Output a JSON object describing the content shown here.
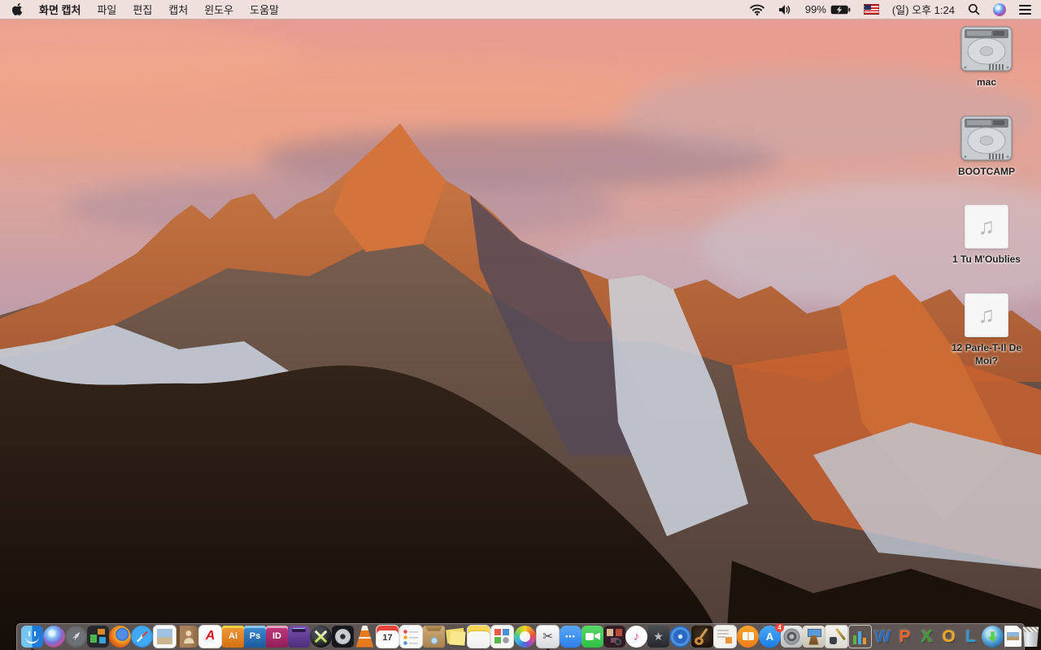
{
  "menu_bar": {
    "app_name": "화면 캡처",
    "menus": [
      "파일",
      "편집",
      "캡처",
      "윈도우",
      "도움말"
    ],
    "battery_percent": "99%",
    "clock": "(일) 오후 1:24"
  },
  "desktop": {
    "icons": [
      {
        "name": "drive-mac",
        "type": "drive",
        "label": "mac"
      },
      {
        "name": "drive-bootcamp",
        "type": "drive",
        "label": "BOOTCAMP"
      },
      {
        "name": "audio-file-1",
        "type": "audio",
        "label": "1 Tu M'Oublies",
        "glyph": "♫"
      },
      {
        "name": "audio-file-2",
        "type": "audio",
        "label": "12 Parle-T-Il De Moi?",
        "glyph": "♫"
      }
    ]
  },
  "dock": {
    "items": [
      {
        "name": "finder",
        "running": true
      },
      {
        "name": "siri"
      },
      {
        "name": "launchpad"
      },
      {
        "name": "mission-control"
      },
      {
        "name": "firefox"
      },
      {
        "name": "safari"
      },
      {
        "name": "preview"
      },
      {
        "name": "contacts"
      },
      {
        "name": "acrobat-reader",
        "glyph": "A"
      },
      {
        "name": "illustrator",
        "glyph": "Ai"
      },
      {
        "name": "photoshop",
        "glyph": "Ps"
      },
      {
        "name": "indesign",
        "glyph": "ID"
      },
      {
        "name": "toast"
      },
      {
        "name": "quicksilver"
      },
      {
        "name": "disk-utility"
      },
      {
        "name": "vlc"
      },
      {
        "name": "calendar",
        "glyph": "17"
      },
      {
        "name": "reminders"
      },
      {
        "name": "unarchiver"
      },
      {
        "name": "stickies"
      },
      {
        "name": "notes"
      },
      {
        "name": "image-capture"
      },
      {
        "name": "photos"
      },
      {
        "name": "grab",
        "glyph": "✂",
        "running": true
      },
      {
        "name": "messages",
        "glyph": "•••"
      },
      {
        "name": "facetime"
      },
      {
        "name": "photo-booth"
      },
      {
        "name": "itunes",
        "glyph": "♪"
      },
      {
        "name": "imovie",
        "glyph": "★"
      },
      {
        "name": "dvd-player"
      },
      {
        "name": "garageband"
      },
      {
        "name": "document-stack"
      },
      {
        "name": "ibooks"
      },
      {
        "name": "app-store",
        "glyph": "A",
        "badge": "4"
      },
      {
        "name": "system-preferences"
      },
      {
        "name": "keynote"
      },
      {
        "name": "pages"
      },
      {
        "name": "numbers"
      },
      {
        "name": "word",
        "glyph": "W"
      },
      {
        "name": "powerpoint",
        "glyph": "P"
      },
      {
        "name": "excel",
        "glyph": "X"
      },
      {
        "name": "outlook",
        "glyph": "O"
      },
      {
        "name": "lync",
        "glyph": "L"
      },
      {
        "name": "ms-autoupdate"
      },
      {
        "name": "dock-separator",
        "type": "separator"
      },
      {
        "name": "document-file",
        "type": "file"
      },
      {
        "name": "trash",
        "type": "trash"
      }
    ]
  }
}
